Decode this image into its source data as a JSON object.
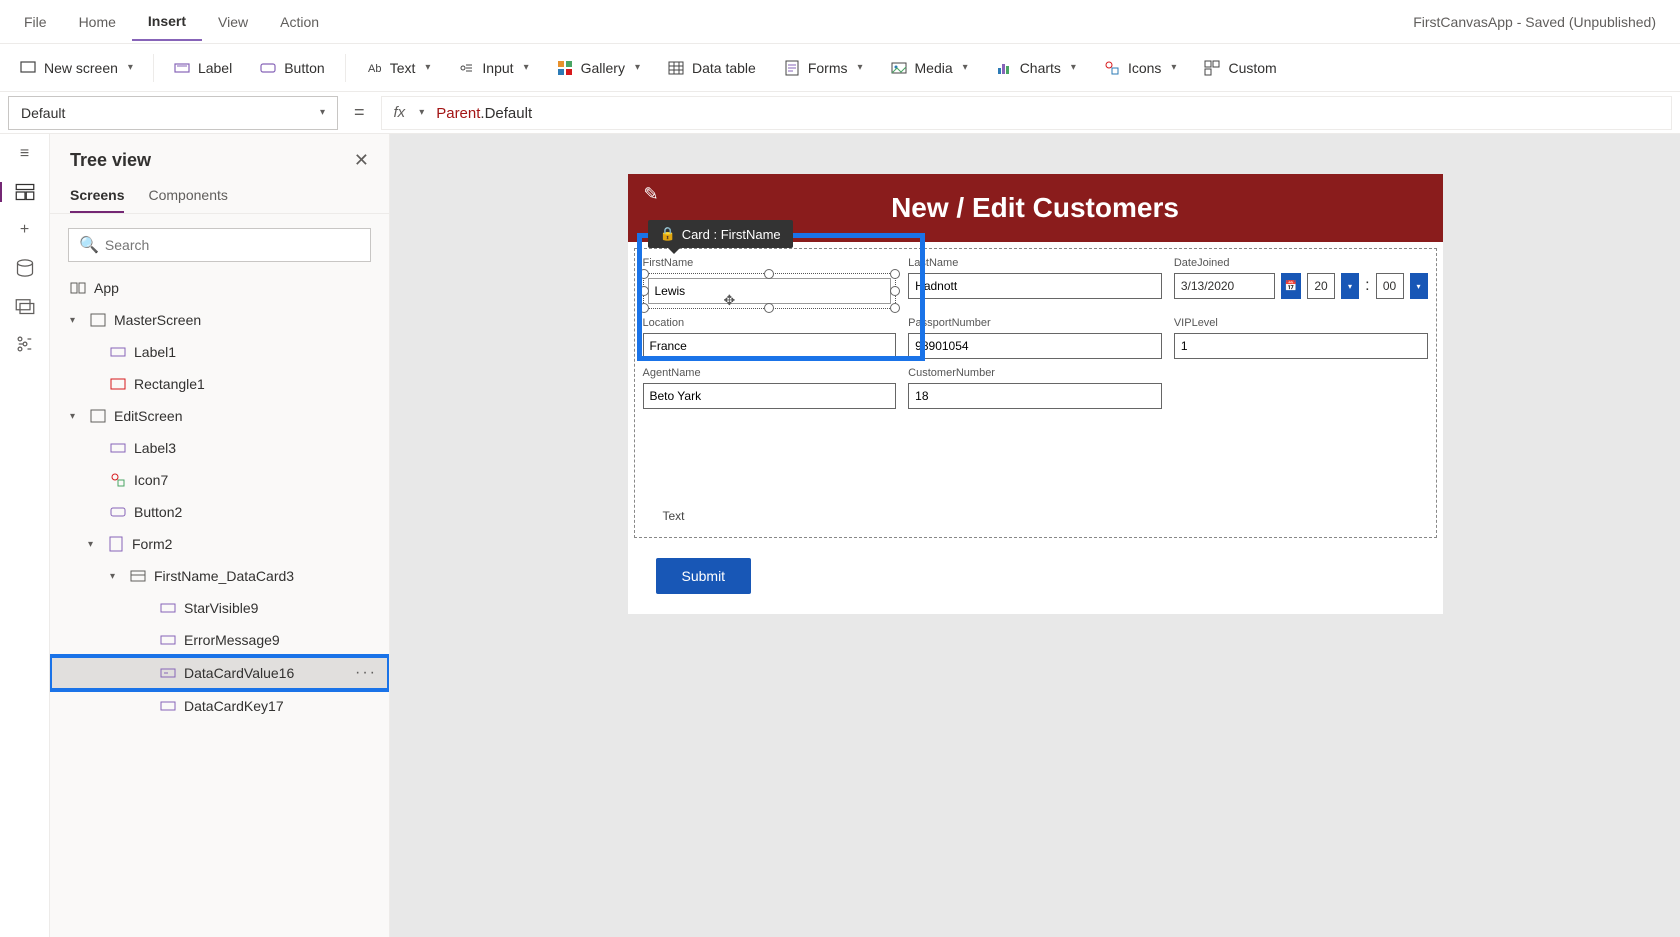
{
  "title_bar": "FirstCanvasApp - Saved (Unpublished)",
  "menu": {
    "file": "File",
    "home": "Home",
    "insert": "Insert",
    "view": "View",
    "action": "Action"
  },
  "ribbon": {
    "new_screen": "New screen",
    "label": "Label",
    "button": "Button",
    "text": "Text",
    "input": "Input",
    "gallery": "Gallery",
    "data_table": "Data table",
    "forms": "Forms",
    "media": "Media",
    "charts": "Charts",
    "icons": "Icons",
    "custom": "Custom"
  },
  "property_selector": "Default",
  "formula": {
    "parent": "Parent",
    "default": ".Default"
  },
  "tree": {
    "title": "Tree view",
    "tabs": {
      "screens": "Screens",
      "components": "Components"
    },
    "search_placeholder": "Search",
    "items": {
      "app": "App",
      "master_screen": "MasterScreen",
      "label1": "Label1",
      "rectangle1": "Rectangle1",
      "edit_screen": "EditScreen",
      "label3": "Label3",
      "icon7": "Icon7",
      "button2": "Button2",
      "form2": "Form2",
      "firstname_dc": "FirstName_DataCard3",
      "star_visible": "StarVisible9",
      "error_msg": "ErrorMessage9",
      "dcv16": "DataCardValue16",
      "dck17": "DataCardKey17"
    }
  },
  "card_tooltip": "Card : FirstName",
  "screen": {
    "heading": "New / Edit Customers",
    "fields": {
      "firstname": {
        "label": "FirstName",
        "value": "Lewis"
      },
      "lastname": {
        "label": "LastName",
        "value": "Hadnott"
      },
      "datejoined": {
        "label": "DateJoined",
        "date": "3/13/2020",
        "hour": "20",
        "min": "00"
      },
      "location": {
        "label": "Location",
        "value": "France"
      },
      "passport": {
        "label": "PassportNumber",
        "value": "98901054"
      },
      "vip": {
        "label": "VIPLevel",
        "value": "1"
      },
      "agent": {
        "label": "AgentName",
        "value": "Beto Yark"
      },
      "custno": {
        "label": "CustomerNumber",
        "value": "18"
      }
    },
    "text_label": "Text",
    "submit": "Submit"
  }
}
